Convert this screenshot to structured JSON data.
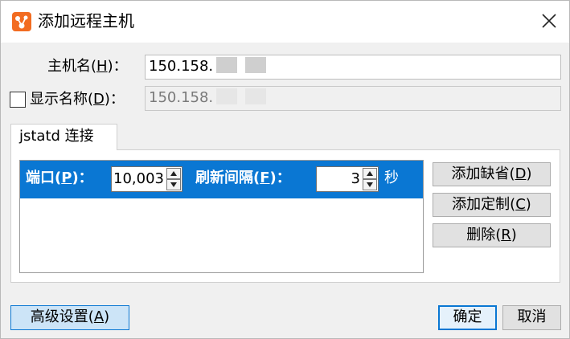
{
  "dialog": {
    "title": "添加远程主机",
    "colors": {
      "accent": "#0a77d3",
      "icon": "#f26c21"
    }
  },
  "form": {
    "hostname": {
      "label_prefix": "主机名(",
      "mnemonic": "H",
      "label_suffix": ")：",
      "value": "150.158."
    },
    "display_name": {
      "label_prefix": "显示名称(",
      "mnemonic": "D",
      "label_suffix": ")：",
      "value": "150.158.",
      "checked": false
    }
  },
  "tab": {
    "label": "jstatd 连接"
  },
  "connection_row": {
    "port_label_prefix": "端口(",
    "port_mnemonic": "P",
    "port_label_suffix": ")：",
    "port_value": "10,003",
    "refresh_label_prefix": "刷新间隔(",
    "refresh_mnemonic": "F",
    "refresh_label_suffix": ")：",
    "refresh_value": "3",
    "unit": "秒"
  },
  "side_buttons": {
    "add_default": {
      "prefix": "添加缺省(",
      "mnemonic": "D",
      "suffix": ")"
    },
    "add_custom": {
      "prefix": "添加定制(",
      "mnemonic": "C",
      "suffix": ")"
    },
    "delete": {
      "prefix": "删除(",
      "mnemonic": "R",
      "suffix": ")"
    }
  },
  "footer": {
    "advanced": {
      "prefix": "高级设置(",
      "mnemonic": "A",
      "suffix": ")"
    },
    "ok": "确定",
    "cancel": "取消"
  }
}
